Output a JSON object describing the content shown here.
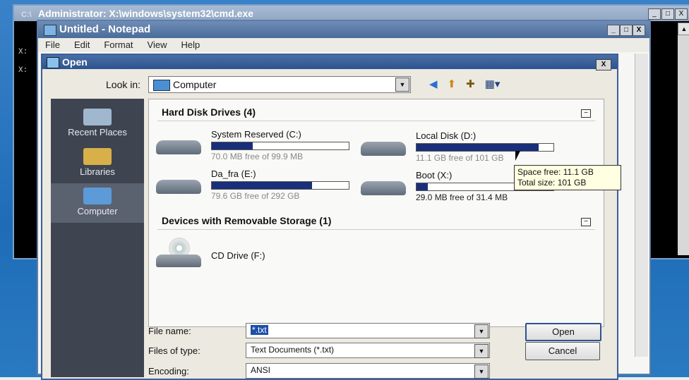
{
  "cmd": {
    "title": "Administrator: X:\\windows\\system32\\cmd.exe",
    "prompt_lines": [
      "X:",
      "X:"
    ],
    "window_buttons": [
      "_",
      "□",
      "X"
    ]
  },
  "notepad": {
    "title": "Untitled - Notepad",
    "menu": [
      "File",
      "Edit",
      "Format",
      "View",
      "Help"
    ],
    "window_buttons": [
      "_",
      "□",
      "X"
    ]
  },
  "dialog": {
    "title": "Open",
    "close": "X",
    "look_in_label": "Look in:",
    "look_in_value": "Computer",
    "toolbar_icons": [
      "back-icon",
      "up-folder-icon",
      "new-folder-icon",
      "view-menu-icon"
    ],
    "places": [
      {
        "label": "Recent Places",
        "selected": false
      },
      {
        "label": "Libraries",
        "selected": false
      },
      {
        "label": "Computer",
        "selected": true
      }
    ],
    "sections": [
      {
        "title": "Hard Disk Drives (4)",
        "collapse": "−"
      },
      {
        "title": "Devices with Removable Storage (1)",
        "collapse": "−"
      }
    ],
    "drives": [
      {
        "name": "System Reserved (C:)",
        "free": "70.0 MB free of 99.9 MB",
        "used_fraction": 0.3
      },
      {
        "name": "Local Disk (D:)",
        "free": "11.1 GB free of 101 GB",
        "used_fraction": 0.89
      },
      {
        "name": "Da_fra (E:)",
        "free": "79.6 GB free of 292 GB",
        "used_fraction": 0.73
      },
      {
        "name": "Boot (X:)",
        "free": "29.0 MB free of 31.4 MB",
        "used_fraction": 0.08
      }
    ],
    "removable": [
      {
        "name": "CD Drive (F:)"
      }
    ],
    "tooltip": {
      "line1": "Space free: 11.1 GB",
      "line2": "Total size: 101 GB"
    },
    "file_name_label": "File name:",
    "file_name_value": "*.txt",
    "file_type_label": "Files of type:",
    "file_type_value": "Text Documents (*.txt)",
    "encoding_label": "Encoding:",
    "encoding_value": "ANSI",
    "open_button": "Open",
    "cancel_button": "Cancel"
  },
  "colors": {
    "bar_fill": "#1a2f7a",
    "dialog_title": "#2d5390",
    "places_bg": "#3e4550"
  }
}
